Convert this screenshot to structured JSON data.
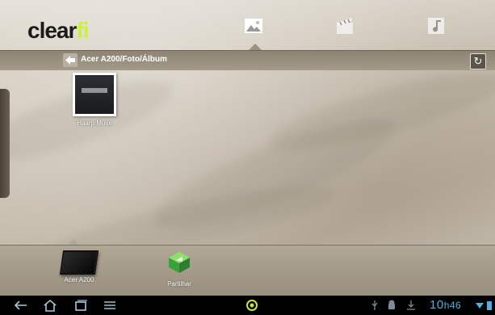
{
  "app": {
    "logo_main": "clear",
    "logo_accent": "fi"
  },
  "tabs": [
    {
      "name": "photos",
      "icon": "photo-icon"
    },
    {
      "name": "videos",
      "icon": "clapperboard-icon"
    },
    {
      "name": "music",
      "icon": "music-note-icon"
    }
  ],
  "path": {
    "label": "Acer A200/Foto/Álbum"
  },
  "album": {
    "label": "Haarp Muse"
  },
  "devices": [
    {
      "label": "Acer A200",
      "icon": "tablet-icon"
    },
    {
      "label": "Partilhar",
      "icon": "share-cube-icon"
    }
  ],
  "status": {
    "time_hour": "10",
    "time_min": "h46"
  },
  "colors": {
    "accent": "#c9f23a",
    "clock": "#4fb0e0"
  }
}
